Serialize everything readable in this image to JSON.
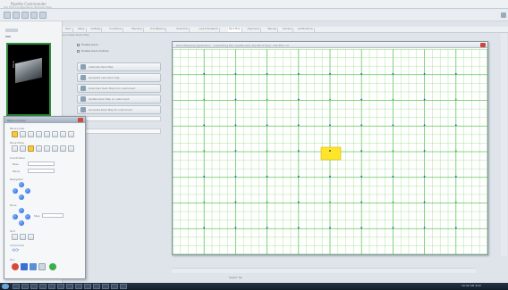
{
  "window": {
    "title": "Pipette Commander",
    "menu": "File  Edit  Configuration  Window  Help"
  },
  "toolbar": {
    "icons": [
      "open-icon",
      "save-icon",
      "print-icon",
      "run-icon",
      "settings-icon"
    ]
  },
  "tabs": [
    {
      "label": "Deck"
    },
    {
      "label": "Setup"
    },
    {
      "label": "Settings"
    },
    {
      "label": "Conditions"
    },
    {
      "label": "Blending"
    },
    {
      "label": "Tool Balance"
    },
    {
      "label": "Dual Error"
    },
    {
      "label": "Loop Framework"
    },
    {
      "label": "Deck Map"
    },
    {
      "label": "Alignment"
    },
    {
      "label": "Manual"
    },
    {
      "label": "Camera"
    },
    {
      "label": "Certifications"
    }
  ],
  "active_tab_index": 8,
  "subtabs": "Annotate   Deck Map",
  "options": {
    "opt1": "Enable Deck",
    "opt2": "Enable Deck Outline"
  },
  "buttons": [
    {
      "label": "Calibrate Deck Map"
    },
    {
      "label": "Generate new deck map"
    },
    {
      "label": "Download Deck Map from instrument"
    },
    {
      "label": "Update Deck Map on instrument"
    },
    {
      "label": "Generate Deck Map for instrument"
    }
  ],
  "fields": {
    "field1_label": "Deck File",
    "field2_label": "Map"
  },
  "preview": {
    "label": "Deck"
  },
  "map_window": {
    "title": "Deck Mapping application - (uploading file: pipette.exe) Top Block Pipe: 100 200 1.0"
  },
  "float_panel": {
    "title": "Motion Control",
    "section1": "Move Joints",
    "section2": "Move Mode",
    "section3": "Coordinates",
    "x_label": "Base",
    "y_label": "Elbow",
    "section4": "Navigation",
    "section5": "Move",
    "step_label": "Step",
    "section6": "Grid",
    "section7": "Commands",
    "section8": "Run"
  },
  "status": {
    "center": "Select Tip"
  },
  "taskbar": {
    "clock": "10:32 AM  4/12"
  },
  "colors": {
    "grid_line": "#9bdc8a",
    "grid_major": "#5fc85a",
    "dot_blue": "#1f4fd8",
    "highlight": "#ffe52a"
  }
}
